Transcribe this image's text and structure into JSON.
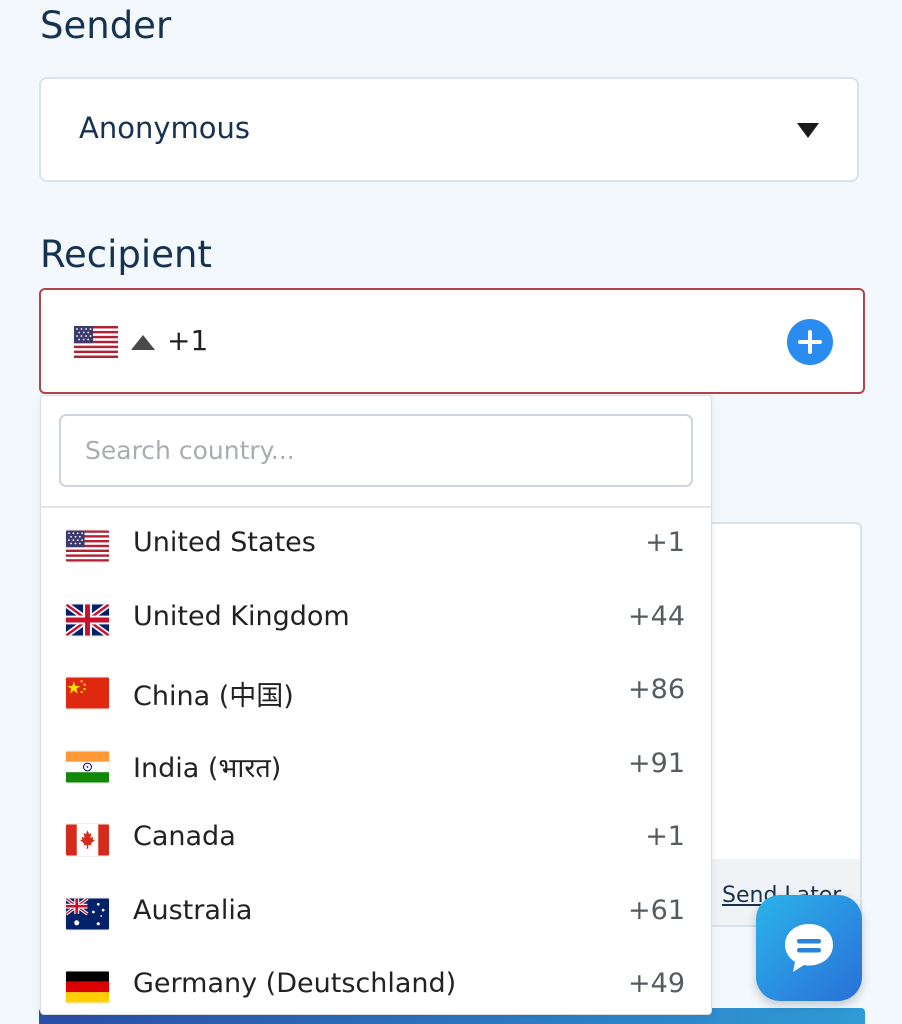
{
  "sender": {
    "label": "Sender",
    "selected": "Anonymous"
  },
  "recipient": {
    "label": "Recipient",
    "flag_icon": "us-flag-icon",
    "dial_code": "+1"
  },
  "country_search": {
    "placeholder": "Search country...",
    "countries": [
      {
        "name": "United States",
        "code": "+1",
        "flag": "us-flag-icon"
      },
      {
        "name": "United Kingdom",
        "code": "+44",
        "flag": "uk-flag-icon"
      },
      {
        "name": "China (中国)",
        "code": "+86",
        "flag": "china-flag-icon"
      },
      {
        "name": "India (भारत)",
        "code": "+91",
        "flag": "india-flag-icon"
      },
      {
        "name": "Canada",
        "code": "+1",
        "flag": "canada-flag-icon"
      },
      {
        "name": "Australia",
        "code": "+61",
        "flag": "australia-flag-icon"
      },
      {
        "name": "Germany (Deutschland)",
        "code": "+49",
        "flag": "germany-flag-icon"
      }
    ]
  },
  "message_panel": {
    "send_later_label": "Send Later"
  },
  "colors": {
    "accent_blue": "#2a8cf0",
    "error_border": "#b3444a",
    "text_primary": "#163251"
  }
}
